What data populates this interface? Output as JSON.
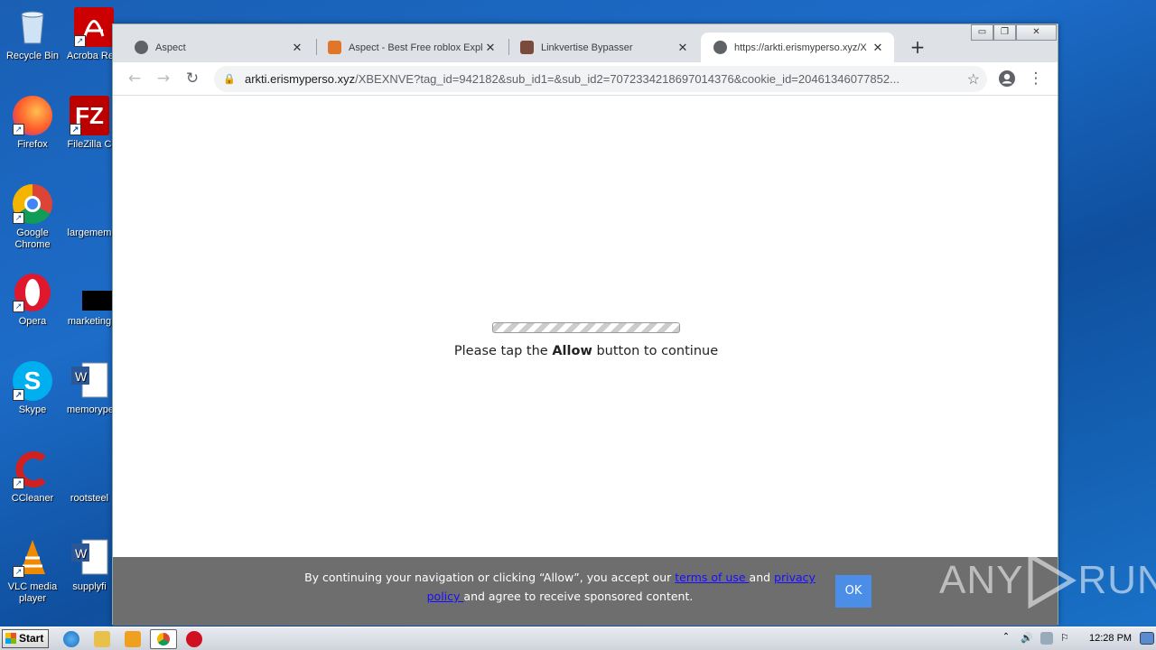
{
  "desktop": {
    "icons": [
      {
        "label": "Recycle Bin"
      },
      {
        "label": "Acrobat Reader DC",
        "visible": "Acroba Reader"
      },
      {
        "label": "Firefox"
      },
      {
        "label": "FileZilla C"
      },
      {
        "label": "Google Chrome"
      },
      {
        "label": "largemem"
      },
      {
        "label": "Opera"
      },
      {
        "label": "marketing"
      },
      {
        "label": "Skype"
      },
      {
        "label": "memorype"
      },
      {
        "label": "CCleaner"
      },
      {
        "label": "rootsteel"
      },
      {
        "label": "VLC media player"
      },
      {
        "label": "supplyfi"
      }
    ]
  },
  "browser": {
    "tabs": [
      {
        "title": "Aspect"
      },
      {
        "title": "Aspect - Best Free roblox Expl"
      },
      {
        "title": "Linkvertise Bypasser"
      },
      {
        "title": "https://arkti.erismyperso.xyz/X"
      }
    ],
    "new_tab": "+",
    "close_glyph": "✕",
    "url_host": "arkti.erismyperso.xyz",
    "url_path": "/XBEXNVE?tag_id=942182&sub_id1=&sub_id2=7072334218697014376&cookie_id=20461346077852...",
    "window_controls": {
      "minimize": "▭",
      "restore": "❐",
      "close": "✕"
    }
  },
  "page": {
    "tap_prefix": "Please tap the ",
    "tap_bold": "Allow",
    "tap_suffix": " button to continue",
    "consent": {
      "text_before": "By continuing your navigation or clicking “Allow”, you accept our ",
      "terms_link": "terms of use ",
      "and": "and ",
      "privacy_link": "privacy policy ",
      "text_after": "and agree to receive sponsored content.",
      "ok_label": "OK"
    }
  },
  "watermark": {
    "left": "ANY",
    "right": "RUN"
  },
  "taskbar": {
    "start_label": "Start",
    "clock": "12:28 PM"
  },
  "colors": {
    "desktop_blue": "#1c6cc8",
    "consent_bar": "#6e6e6e",
    "ok_button": "#4b8ee8",
    "link": "#1a0dff"
  }
}
